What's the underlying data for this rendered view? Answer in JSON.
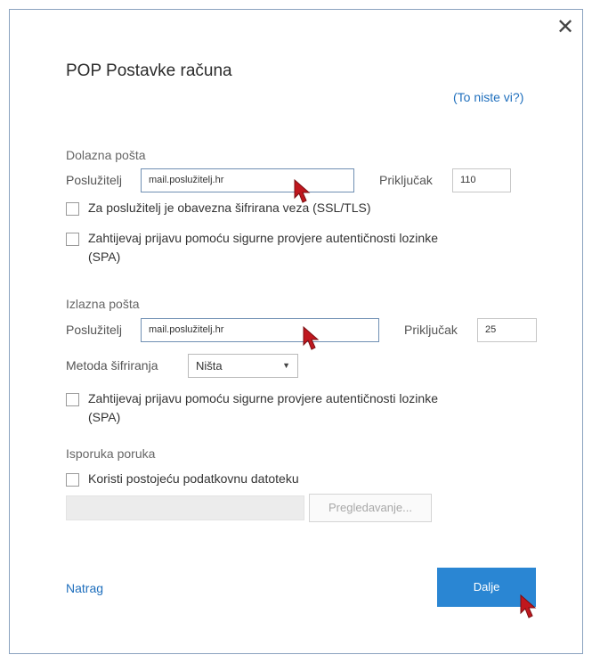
{
  "dialog": {
    "title": "POP Postavke računa",
    "not_you_link": "(To niste vi?)",
    "close_glyph": "✕"
  },
  "incoming": {
    "section_label": "Dolazna pošta",
    "server_label": "Poslužitelj",
    "server_value": "mail.poslužitelj.hr",
    "port_label": "Priključak",
    "port_value": "110",
    "ssl_label": "Za poslužitelj je obavezna šifrirana veza (SSL/TLS)",
    "ssl_checked": false,
    "spa_label_line1": "Zahtijevaj prijavu pomoću sigurne provjere autentičnosti lozinke",
    "spa_label_line2": "(SPA)",
    "spa_checked": false
  },
  "outgoing": {
    "section_label": "Izlazna pošta",
    "server_label": "Poslužitelj",
    "server_value": "mail.poslužitelj.hr",
    "port_label": "Priključak",
    "port_value": "25",
    "encryption_label": "Metoda šifriranja",
    "encryption_value": "Ništa",
    "spa_label_line1": "Zahtijevaj prijavu pomoću sigurne provjere autentičnosti lozinke",
    "spa_label_line2": "(SPA)",
    "spa_checked": false
  },
  "delivery": {
    "section_label": "Isporuka poruka",
    "existing_file_label": "Koristi postojeću podatkovnu datoteku",
    "existing_file_checked": false,
    "browse_label": "Pregledavanje..."
  },
  "footer": {
    "back_label": "Natrag",
    "next_label": "Dalje"
  },
  "colors": {
    "accent": "#2a86d3",
    "link": "#1f6fbd",
    "cursor_pointer": "#c0171e"
  },
  "icons": [
    "close-icon",
    "checkbox-unchecked-icon",
    "dropdown-caret-icon",
    "mouse-pointer-icon"
  ]
}
